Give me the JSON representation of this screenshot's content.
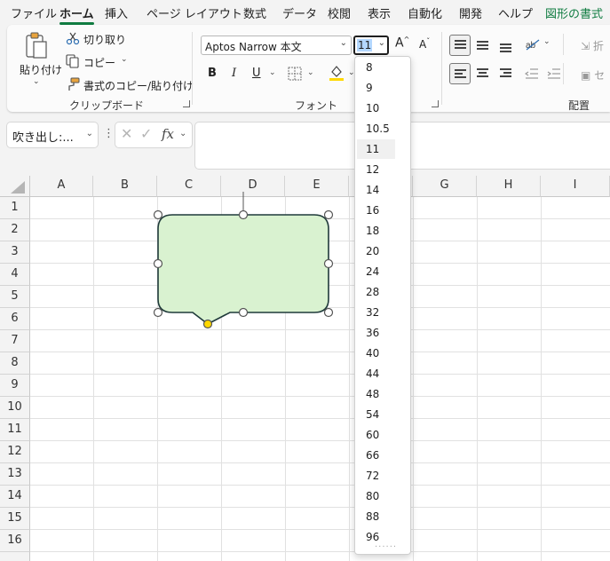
{
  "tabs": [
    "ファイル",
    "ホーム",
    "挿入",
    "ページ レイアウト",
    "数式",
    "データ",
    "校閲",
    "表示",
    "自動化",
    "開発",
    "ヘルプ",
    "図形の書式"
  ],
  "clipboard": {
    "paste_label": "貼り付け",
    "cut_label": "切り取り",
    "copy_label": "コピー",
    "format_painter_label": "書式のコピー/貼り付け",
    "group_label": "クリップボード"
  },
  "font": {
    "font_name": "Aptos Narrow 本文",
    "font_size": "11",
    "increase_label": "A",
    "decrease_label": "A",
    "bold_label": "B",
    "italic_label": "I",
    "underline_label": "U",
    "group_label": "フォント"
  },
  "alignment": {
    "wrap_label": "折",
    "merge_label": "セ",
    "group_label": "配置"
  },
  "formula_bar": {
    "name_box": "吹き出し:...",
    "fx_label": "fx",
    "formula_value": ""
  },
  "sheet": {
    "columns": [
      "A",
      "B",
      "C",
      "D",
      "E",
      "F",
      "G",
      "H",
      "I"
    ],
    "rows": [
      "1",
      "2",
      "3",
      "4",
      "5",
      "6",
      "7",
      "8",
      "9",
      "10",
      "11",
      "12",
      "13",
      "14",
      "15",
      "16"
    ]
  },
  "shape": {
    "type": "rounded-rectangle-callout",
    "fill": "#d9f2d0",
    "stroke": "#1f3a3a"
  },
  "font_size_dropdown": {
    "selected": "11",
    "options": [
      "8",
      "9",
      "10",
      "10.5",
      "11",
      "12",
      "14",
      "16",
      "18",
      "20",
      "24",
      "28",
      "32",
      "36",
      "40",
      "44",
      "48",
      "54",
      "60",
      "66",
      "72",
      "80",
      "88",
      "96"
    ]
  },
  "colors": {
    "accent_green": "#107c41",
    "highlight_yellow": "#ffd800"
  }
}
